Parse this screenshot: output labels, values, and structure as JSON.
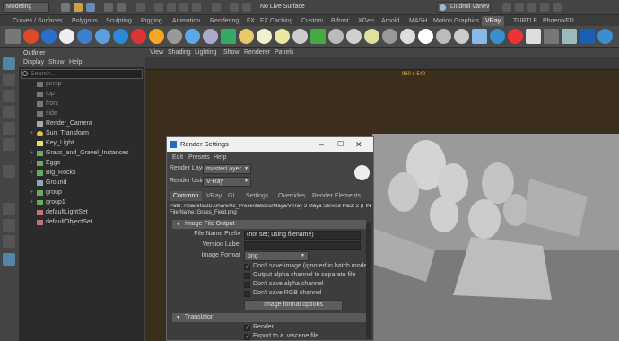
{
  "status_line": {
    "menu_set": "Modeling",
    "live_surface": "No Live Surface",
    "user": "Liudmil Vanev"
  },
  "shelf_tabs": [
    "Curves / Surfaces",
    "Polygons",
    "Sculpting",
    "Rigging",
    "Animation",
    "Rendering",
    "FX",
    "FX Caching",
    "Custom",
    "Bifrost",
    "XGen",
    "Arnold",
    "MASH",
    "Motion Graphics",
    "VRay",
    "TURTLE",
    "PhoenixFD"
  ],
  "active_shelf": "VRay",
  "outliner": {
    "title": "Outliner",
    "menu": [
      "Display",
      "Show",
      "Help"
    ],
    "search_placeholder": "Search...",
    "items": [
      {
        "label": "persp",
        "dim": true
      },
      {
        "label": "top",
        "dim": true
      },
      {
        "label": "front",
        "dim": true
      },
      {
        "label": "side",
        "dim": true
      },
      {
        "label": "Render_Camera",
        "dim": false
      },
      {
        "label": "Sun_Transform",
        "dim": false
      },
      {
        "label": "Key_Light",
        "dim": false
      },
      {
        "label": "Grass_and_Gravel_Instances",
        "dim": false
      },
      {
        "label": "Eggs",
        "dim": false
      },
      {
        "label": "Big_Rocks",
        "dim": false
      },
      {
        "label": "Ground",
        "dim": false
      },
      {
        "label": "group",
        "dim": false
      },
      {
        "label": "group1",
        "dim": false
      },
      {
        "label": "defaultLightSet",
        "dim": false
      },
      {
        "label": "defaultObjectSet",
        "dim": false
      }
    ]
  },
  "viewport": {
    "menu": [
      "View",
      "Shading",
      "Lighting",
      "Show",
      "Renderer",
      "Panels"
    ],
    "resolution": "960 x 540"
  },
  "render_settings": {
    "title": "Render Settings",
    "menu": [
      "Edit",
      "Presets",
      "Help"
    ],
    "render_layer_label": "Render Layer",
    "render_layer_value": "masterLayer",
    "render_using_label": "Render Using",
    "render_using_value": "V-Ray",
    "tabs": [
      "Common",
      "VRay",
      "GI",
      "Settings",
      "Overrides",
      "Render Elements"
    ],
    "active_tab": "Common",
    "path_line": "Path: //bladefs/3D.Share/02_Presentations/Maya/V-Ray 3 Maya Service Pack 2 (FINE)/proje",
    "file_name_line": "File Name: Grass_Field.png",
    "sections": {
      "image_output": "Image File Output",
      "translator": "Translator"
    },
    "file_name_prefix_label": "File Name Prefix",
    "file_name_prefix_value": "(not set; using filename)",
    "version_label": "Version Label",
    "version_value": "",
    "image_format_label": "Image Format",
    "image_format_value": "png",
    "checks": [
      {
        "label": "Don't save image (ignored in batch mode)",
        "on": true
      },
      {
        "label": "Output alpha channel to separate file",
        "on": false
      },
      {
        "label": "Don't save alpha channel",
        "on": false
      },
      {
        "label": "Don't save RGB channel",
        "on": false
      }
    ],
    "image_format_options_button": "Image format options",
    "translator_checks": [
      {
        "label": "Render",
        "on": true
      },
      {
        "label": "Export to a .vrscene file",
        "on": true
      }
    ]
  }
}
